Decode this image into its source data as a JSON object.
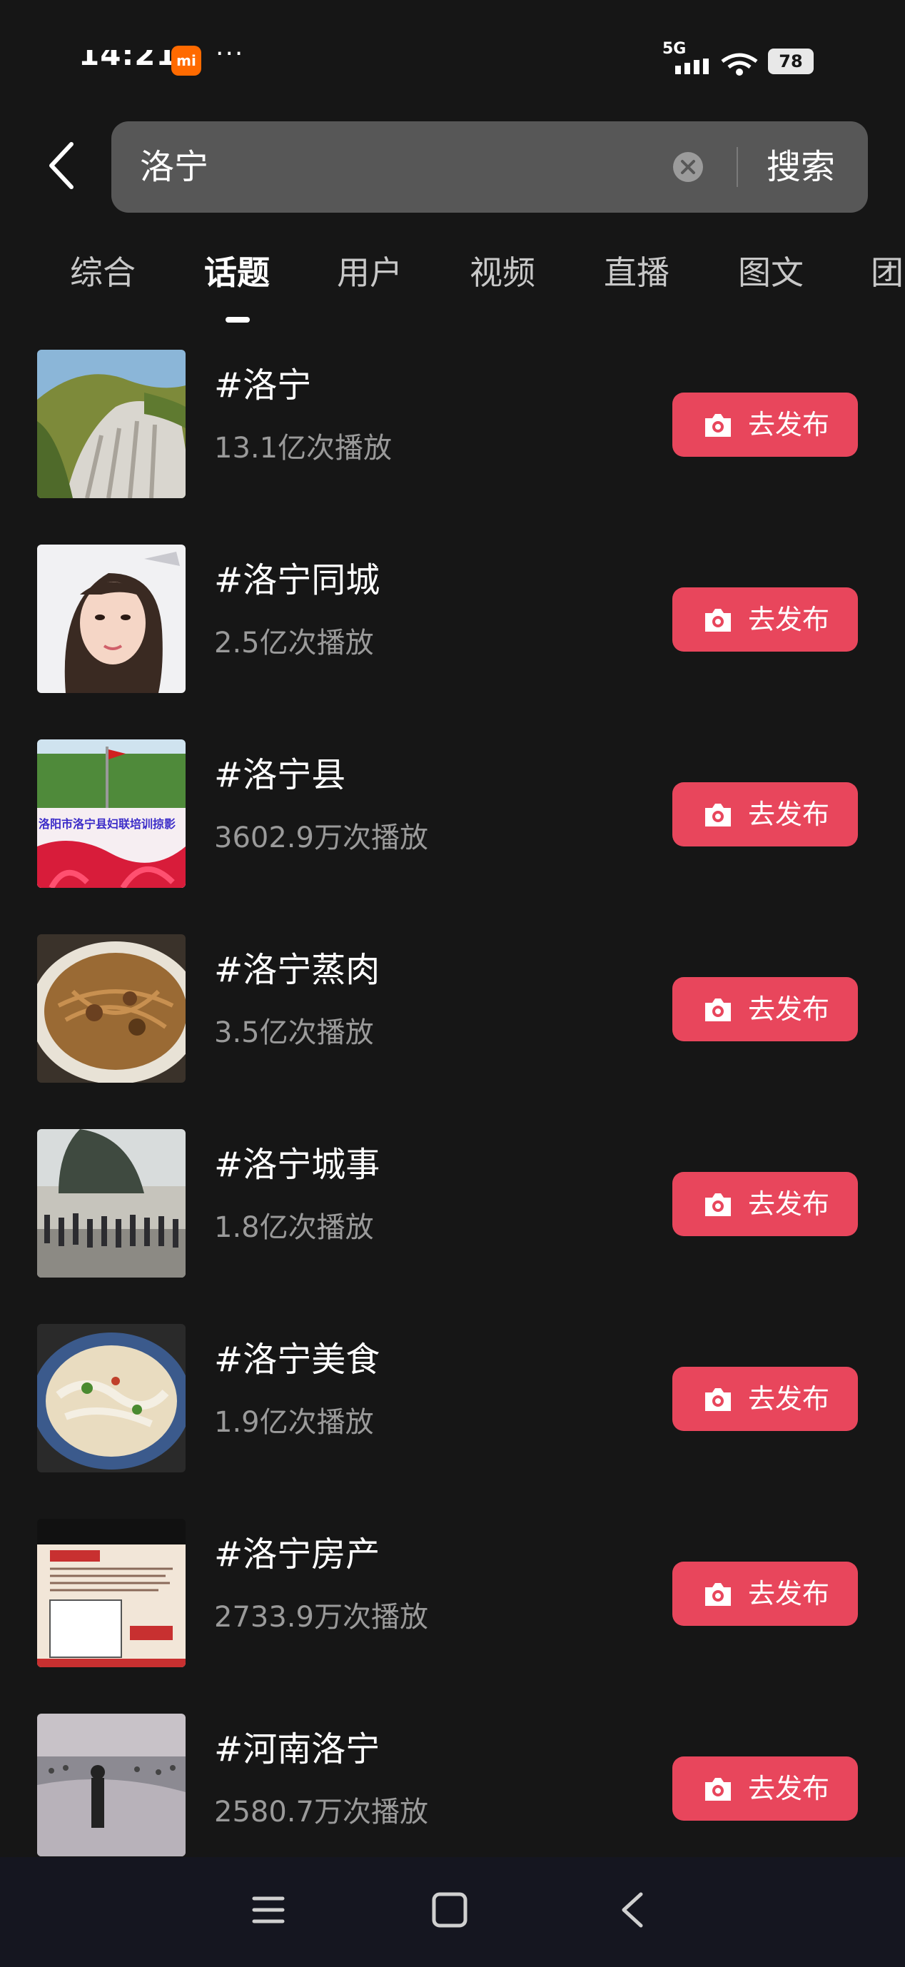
{
  "status_bar": {
    "time": "14:21",
    "app_badge": "mi",
    "more_dots": "···",
    "network": "5G",
    "battery": "78"
  },
  "search": {
    "query": "洛宁",
    "submit_label": "搜索"
  },
  "tabs": [
    {
      "label": "综合",
      "active": false
    },
    {
      "label": "话题",
      "active": true
    },
    {
      "label": "用户",
      "active": false
    },
    {
      "label": "视频",
      "active": false
    },
    {
      "label": "直播",
      "active": false
    },
    {
      "label": "图文",
      "active": false
    },
    {
      "label": "团",
      "active": false
    }
  ],
  "topics": [
    {
      "title": "#洛宁",
      "plays": "13.1亿次播放",
      "button": "去发布",
      "thumb_icon": "mountain-cliff-image"
    },
    {
      "title": "#洛宁同城",
      "plays": "2.5亿次播放",
      "button": "去发布",
      "thumb_icon": "woman-portrait-image"
    },
    {
      "title": "#洛宁县",
      "plays": "3602.9万次播放",
      "button": "去发布",
      "thumb_icon": "banner-trees-image",
      "thumb_text": "洛阳市洛宁县妇联培训掠影"
    },
    {
      "title": "#洛宁蒸肉",
      "plays": "3.5亿次播放",
      "button": "去发布",
      "thumb_icon": "steamed-meat-dish-image"
    },
    {
      "title": "#洛宁城事",
      "plays": "1.8亿次播放",
      "button": "去发布",
      "thumb_icon": "crowd-tree-image"
    },
    {
      "title": "#洛宁美食",
      "plays": "1.9亿次播放",
      "button": "去发布",
      "thumb_icon": "noodle-bowl-image"
    },
    {
      "title": "#洛宁房产",
      "plays": "2733.9万次播放",
      "button": "去发布",
      "thumb_icon": "real-estate-flyer-image"
    },
    {
      "title": "#河南洛宁",
      "plays": "2580.7万次播放",
      "button": "去发布",
      "thumb_icon": "river-beach-image"
    }
  ],
  "colors": {
    "background": "#161616",
    "accent": "#e8465c",
    "search_box": "#575757",
    "muted_text": "#9a9a9a",
    "nav_bar": "#151620"
  },
  "nav": {
    "icons": [
      "menu-icon",
      "home-square-icon",
      "back-chevron-icon"
    ]
  }
}
